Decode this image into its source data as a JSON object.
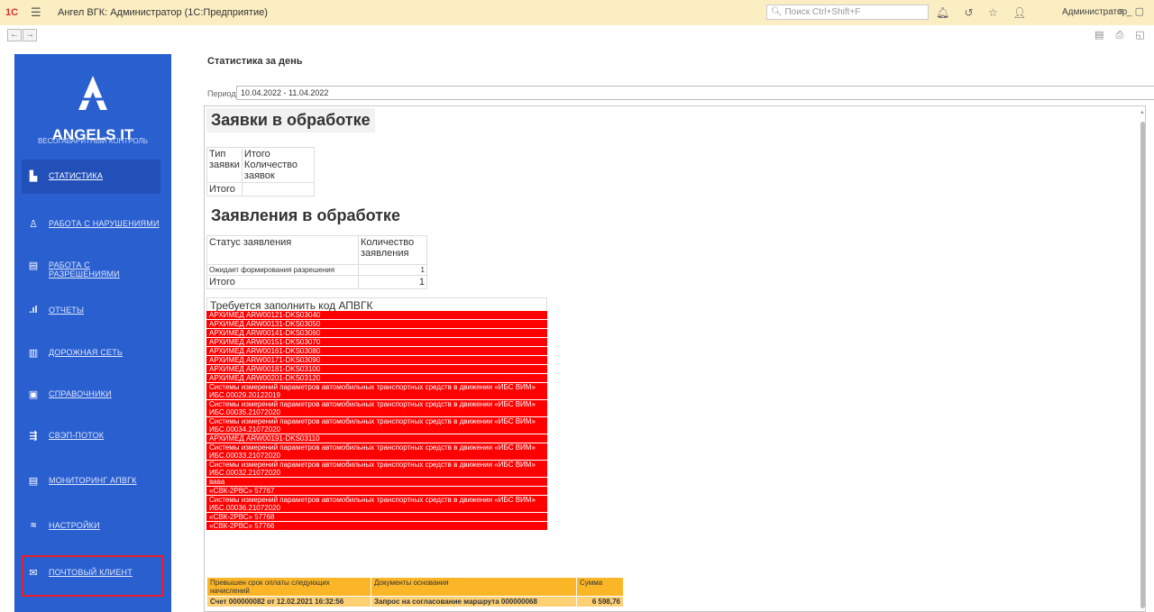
{
  "titlebar": {
    "logo": "1С",
    "title": "Ангел ВГК: Администратор  (1С:Предприятие)",
    "search_placeholder": "Поиск Ctrl+Shift+F",
    "user": "Администратор"
  },
  "sidebar": {
    "brand": "ANGELS IT",
    "brand_sub": "ВЕСОГАБАРИТНЫЙ КОНТРОЛЬ",
    "items": [
      {
        "label": "СТАТИСТИКА",
        "icon": "chart-icon",
        "active": true
      },
      {
        "label": "РАБОТА С НАРУШЕНИЯМИ",
        "icon": "person-icon",
        "active": false
      },
      {
        "label": "РАБОТА С РАЗРЕШЕНИЯМИ",
        "icon": "document-icon",
        "active": false
      },
      {
        "label": "ОТЧЕТЫ",
        "icon": "bars-icon",
        "active": false
      },
      {
        "label": "ДОРОЖНАЯ СЕТЬ",
        "icon": "map-icon",
        "active": false
      },
      {
        "label": "СПРАВОЧНИКИ",
        "icon": "book-icon",
        "active": false
      },
      {
        "label": "СВЭП-ПОТОК",
        "icon": "flow-icon",
        "active": false
      },
      {
        "label": "МОНИТОРИНГ АПВГК",
        "icon": "monitor-icon",
        "active": false
      },
      {
        "label": "НАСТРОЙКИ",
        "icon": "sliders-icon",
        "active": false
      },
      {
        "label": "ПОЧТОВЫЙ КЛИЕНТ",
        "icon": "mail-icon",
        "active": false
      }
    ]
  },
  "main": {
    "title": "Статистика за день",
    "period_label": "Период:",
    "period_value": "10.04.2022 - 11.04.2022"
  },
  "report": {
    "section1": {
      "title": "Заявки в обработке",
      "col1": "Тип заявки",
      "col2_a": "Итого",
      "col2_b": "Количество заявок",
      "total": "Итого"
    },
    "section2": {
      "title": "Заявления в обработке",
      "col1": "Статус заявления",
      "col2": "Количество заявления",
      "row_label": "Ожидает формирования разрешения",
      "row_value": "1",
      "total": "Итого",
      "total_value": "1"
    },
    "section3": {
      "title": "Требуется заполнить код АПВГК",
      "rows": [
        "АРХИМЕД ARW00121-DKS03040",
        "АРХИМЕД ARW00131-DKS03050",
        "АРХИМЕД ARW00141-DKS03060",
        "АРХИМЕД ARW00151-DKS03070",
        "АРХИМЕД ARW00161-DKS03080",
        "АРХИМЕД ARW00171-DKS03090",
        "АРХИМЕД ARW00181-DKS03100",
        "АРХИМЕД ARW00201-DKS03120",
        "Системы измерений параметров автомобильных транспортных средств в движении «ИБС ВИМ» ИБС.00029.20122019",
        "Системы измерений параметров автомобильных транспортных средств в движении «ИБС ВИМ» ИБС.00035.21072020",
        "Системы измерений параметров автомобильных транспортных средств в движении «ИБС ВИМ» ИБС.00034.21072020",
        "АРХИМЕД ARW00191-DKS03110",
        "Системы измерений параметров автомобильных транспортных средств в движении «ИБС ВИМ» ИБС.00033.21072020",
        "Системы измерений параметров автомобильных транспортных средств в движении «ИБС ВИМ» ИБС.00032.21072020",
        "вава",
        "«СВК-2РВС» 57767",
        "Системы измерений параметров автомобильных транспортных средств в движении «ИБС ВИМ» ИБС.00036.21072020",
        "«СВК-2РВС» 57768",
        "«СВК-2РВС» 57766"
      ]
    },
    "section4": {
      "col1": "Превышен срок оплаты следующих начислений",
      "col2": "Документы основания",
      "col3": "Сумма",
      "row": {
        "c1": "Счет 000000082 от 12.02.2021 16:32:56",
        "c2": "Запрос на согласование маршрута 000000068",
        "c3": "6 598,76"
      }
    }
  },
  "colors": {
    "sidebar": "#2a5fd0",
    "alert_red": "#ff0000",
    "warn_orange": "#fbb628",
    "titlebar": "#fbeec3"
  }
}
